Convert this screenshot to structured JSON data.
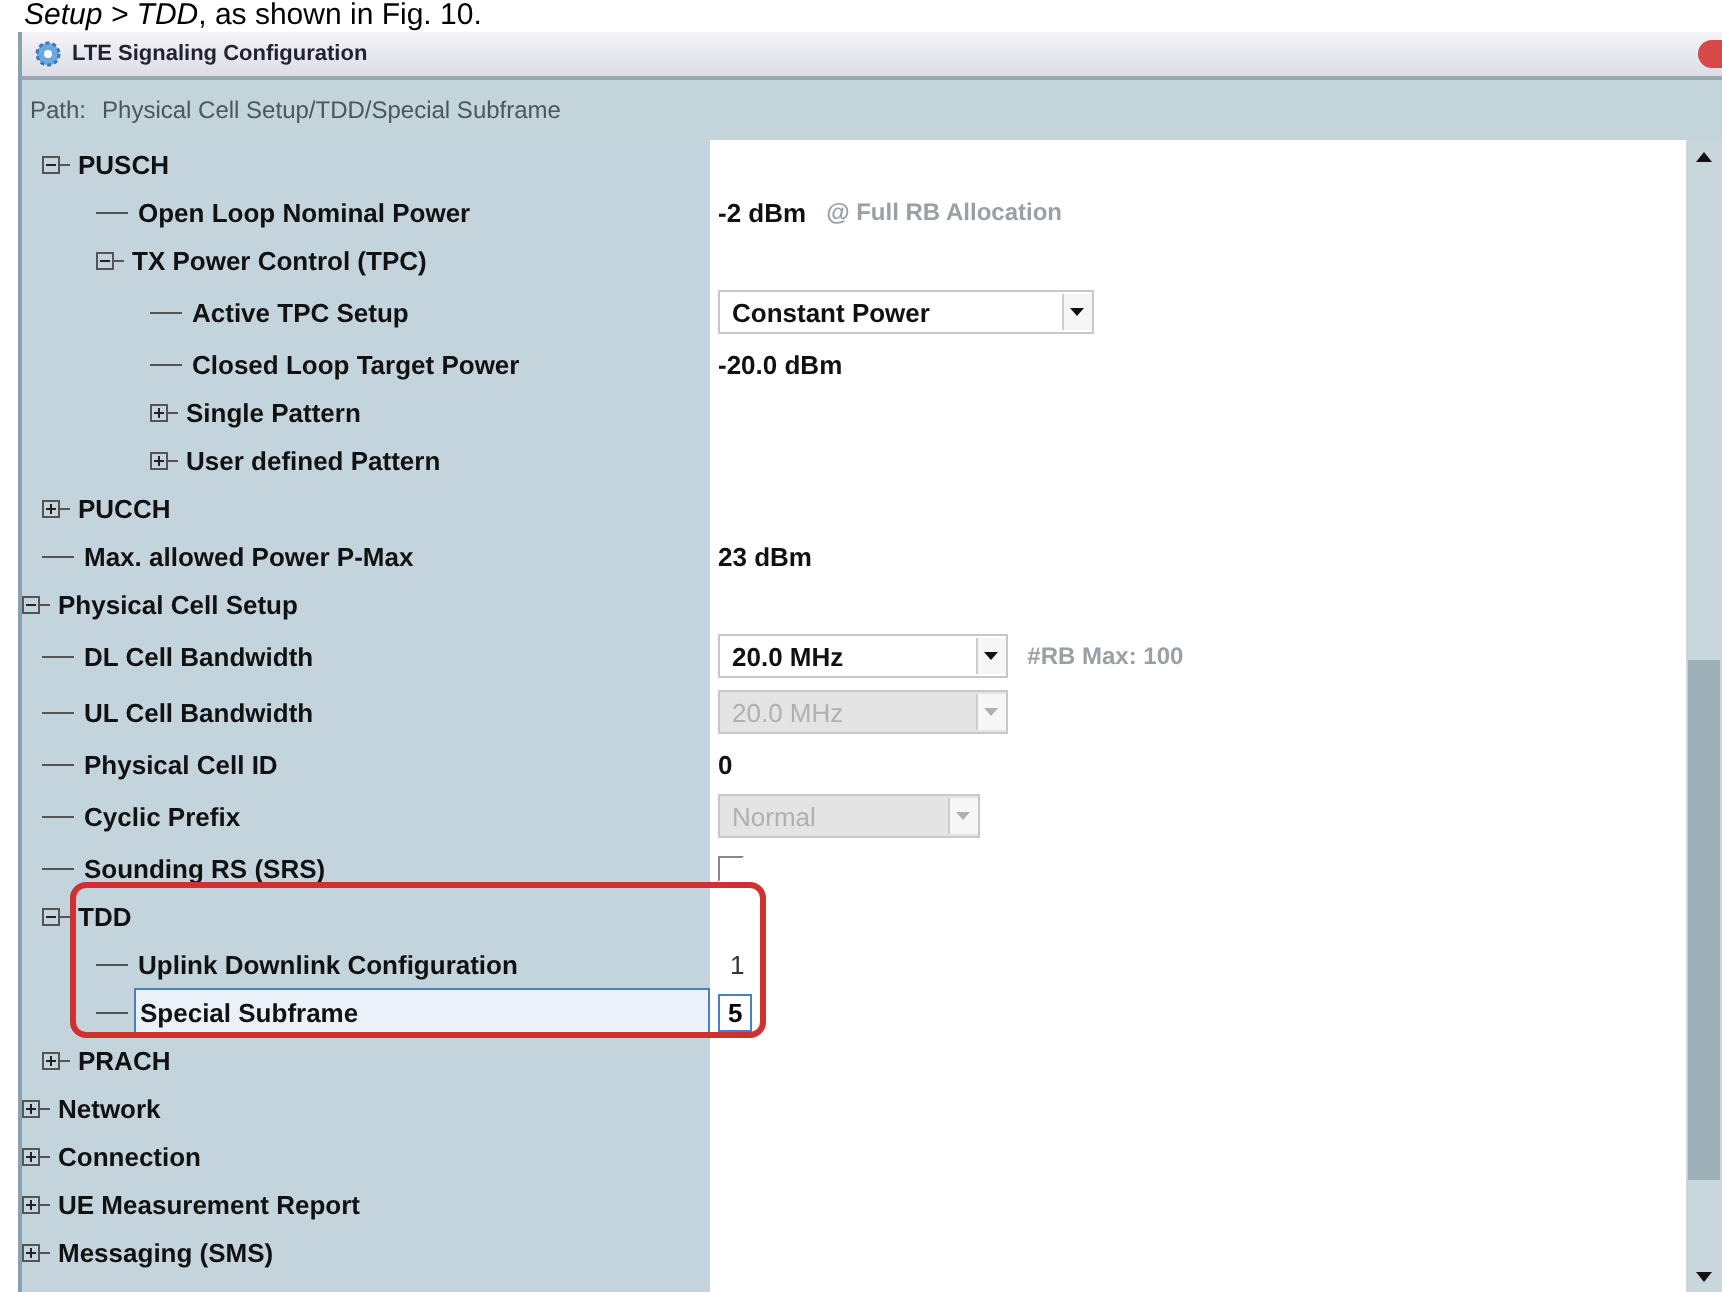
{
  "caption": "*Setup > TDD*, as shown in Fig. 10.",
  "window": {
    "title": "LTE Signaling Configuration"
  },
  "path": {
    "label": "Path:",
    "value": "Physical Cell Setup/TDD/Special Subframe"
  },
  "tree": [
    {
      "children": [
        {
          "label": "PUSCH",
          "expanded": true,
          "selected": false,
          "children": [
            {
              "label": "Open Loop Nominal Power",
              "selected": false,
              "value": {
                "kind": "text",
                "text": "-2 dBm",
                "note": "@ Full RB Allocation"
              }
            },
            {
              "label": "TX Power Control (TPC)",
              "expanded": true,
              "selected": false,
              "children": [
                {
                  "label": "Active TPC Setup",
                  "selected": false,
                  "value": {
                    "kind": "dropdown",
                    "text": "Constant Power",
                    "disabled": false
                  }
                },
                {
                  "label": "Closed Loop Target Power",
                  "selected": false,
                  "value": {
                    "kind": "text",
                    "text": "-20.0 dBm"
                  }
                },
                {
                  "label": "Single Pattern",
                  "expanded": false,
                  "selected": false
                },
                {
                  "label": "User defined Pattern",
                  "expanded": false,
                  "selected": false
                }
              ]
            }
          ]
        },
        {
          "label": "PUCCH",
          "expanded": false,
          "selected": false
        },
        {
          "label": "Max. allowed Power P-Max",
          "selected": false,
          "value": {
            "kind": "text",
            "text": "23 dBm"
          }
        }
      ]
    },
    {
      "label": "Physical Cell Setup",
      "expanded": true,
      "selected": false,
      "children": [
        {
          "label": "DL Cell Bandwidth",
          "selected": false,
          "value": {
            "kind": "dropdown",
            "text": "20.0 MHz",
            "disabled": false,
            "note": "#RB Max:  100"
          }
        },
        {
          "label": "UL Cell Bandwidth",
          "selected": false,
          "value": {
            "kind": "dropdown",
            "text": "20.0 MHz",
            "disabled": true
          }
        },
        {
          "label": "Physical Cell ID",
          "selected": false,
          "value": {
            "kind": "text",
            "text": "0"
          }
        },
        {
          "label": "Cyclic Prefix",
          "selected": false,
          "value": {
            "kind": "dropdown",
            "text": "Normal",
            "disabled": true
          }
        },
        {
          "label": "Sounding RS (SRS)",
          "selected": false,
          "value": {
            "kind": "checkbox",
            "checked": false
          }
        },
        {
          "label": "TDD",
          "expanded": true,
          "selected": false,
          "highlight": true,
          "children": [
            {
              "label": "Uplink Downlink Configuration",
              "selected": false,
              "value": {
                "kind": "plain",
                "text": "1"
              }
            },
            {
              "label": "Special Subframe",
              "selected": true,
              "value": {
                "kind": "field",
                "text": "5"
              }
            }
          ]
        },
        {
          "label": "PRACH",
          "expanded": false,
          "selected": false
        }
      ]
    },
    {
      "label": "Network",
      "expanded": false,
      "selected": false
    },
    {
      "label": "Connection",
      "expanded": false,
      "selected": false
    },
    {
      "label": "UE Measurement Report",
      "expanded": false,
      "selected": false
    },
    {
      "label": "Messaging (SMS)",
      "expanded": false,
      "selected": false
    }
  ]
}
